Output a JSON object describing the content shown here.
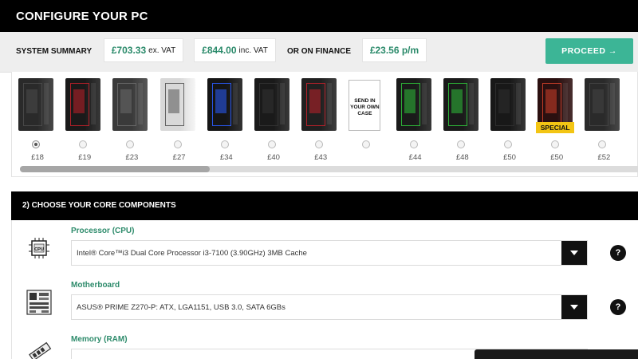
{
  "header": {
    "title": "CONFIGURE YOUR PC"
  },
  "summary": {
    "label": "SYSTEM SUMMARY",
    "price_ex_vat": "£703.33",
    "ex_vat_suffix": "ex. VAT",
    "price_inc_vat": "£844.00",
    "inc_vat_suffix": "inc. VAT",
    "finance_label": "OR ON FINANCE",
    "finance_price": "£23.56 p/m",
    "proceed_label": "PROCEED →"
  },
  "cases": [
    {
      "price": "£18",
      "selected": true,
      "color": "#2a2a2a",
      "accent": "#4a4a4a"
    },
    {
      "price": "£19",
      "selected": false,
      "color": "#1a1a1a",
      "accent": "#c0202a"
    },
    {
      "price": "£23",
      "selected": false,
      "color": "#3a3a3a",
      "accent": "#6a6a6a"
    },
    {
      "price": "£27",
      "selected": false,
      "color": "#d8d8d8",
      "accent": "#555555"
    },
    {
      "price": "£34",
      "selected": false,
      "color": "#151515",
      "accent": "#2a5cff"
    },
    {
      "price": "£40",
      "selected": false,
      "color": "#1a1a1a",
      "accent": "#333333"
    },
    {
      "price": "£43",
      "selected": false,
      "color": "#202020",
      "accent": "#c0202a"
    },
    {
      "price": "",
      "selected": false,
      "send_text": "SEND IN YOUR OWN CASE"
    },
    {
      "price": "£44",
      "selected": false,
      "color": "#1a1a1a",
      "accent": "#2fbf3a"
    },
    {
      "price": "£48",
      "selected": false,
      "color": "#1a1a1a",
      "accent": "#2fbf3a"
    },
    {
      "price": "£50",
      "selected": false,
      "color": "#181818",
      "accent": "#303030"
    },
    {
      "price": "£50",
      "selected": false,
      "color": "#2a1010",
      "accent": "#d0402a",
      "badge": "SPECIAL"
    },
    {
      "price": "£52",
      "selected": false,
      "color": "#2a2a2a",
      "accent": "#444444"
    }
  ],
  "section2": {
    "title": "2) CHOOSE YOUR CORE COMPONENTS",
    "components": [
      {
        "label": "Processor (CPU)",
        "value": "Intel® Core™i3 Dual Core Processor i3-7100 (3.90GHz) 3MB Cache",
        "icon": "cpu-icon"
      },
      {
        "label": "Motherboard",
        "value": "ASUS® PRIME Z270-P: ATX, LGA1151, USB 3.0, SATA 6GBs",
        "icon": "motherboard-icon"
      },
      {
        "label": "Memory (RAM)",
        "value": "",
        "icon": "ram-icon"
      }
    ],
    "help_label": "?"
  },
  "colors": {
    "accent_green": "#3cb596",
    "label_green": "#2d8b6b",
    "dark": "#000000"
  }
}
